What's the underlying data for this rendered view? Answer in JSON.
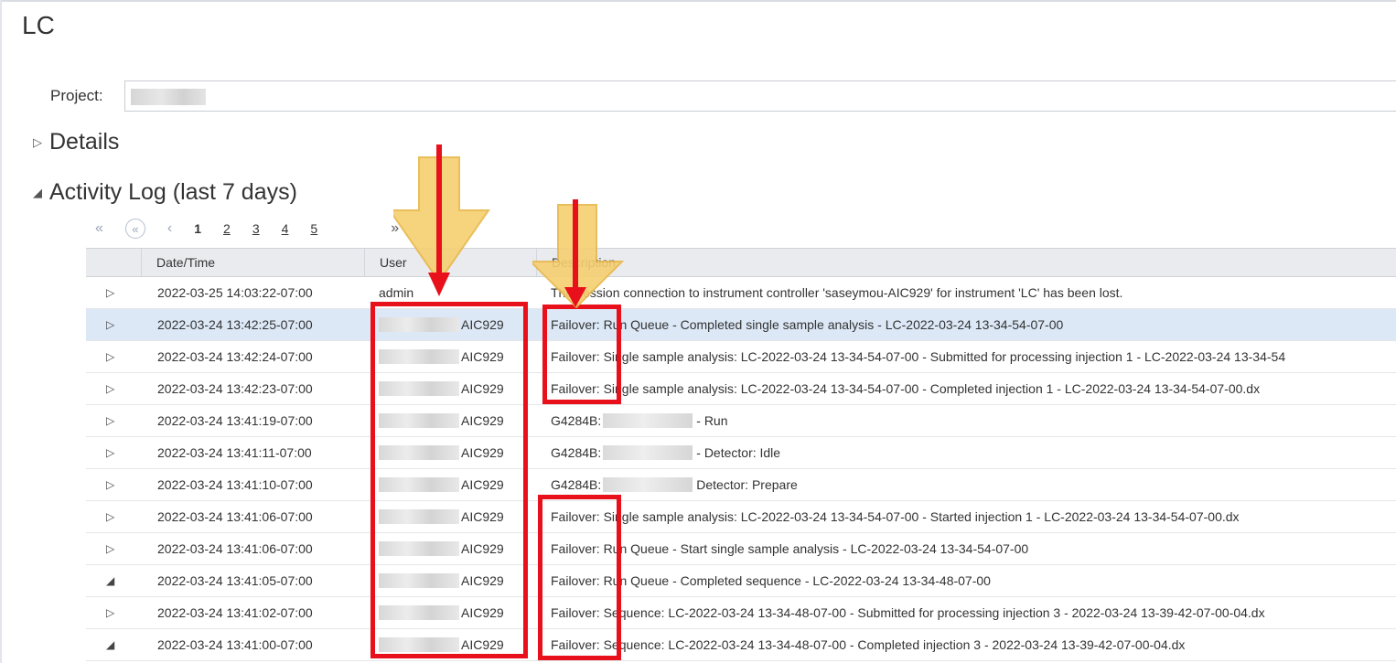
{
  "app": {
    "title": "LC"
  },
  "project": {
    "label": "Project:"
  },
  "sections": {
    "details": {
      "toggle": "▷",
      "label": "Details"
    },
    "activity": {
      "toggle": "◢",
      "label": "Activity Log (last 7 days)"
    }
  },
  "pager": {
    "first": "«",
    "prev_block": "«",
    "prev": "‹",
    "pages": [
      "1",
      "2",
      "3",
      "4",
      "5"
    ],
    "next_block": "»",
    "current": "1"
  },
  "table": {
    "columns": [
      "Date/Time",
      "User",
      "Description"
    ],
    "rows": [
      {
        "expand": "▷",
        "datetime": "2022-03-25 14:03:22-07:00",
        "user": "admin",
        "desc_pre": "",
        "desc": "The session connection to instrument controller 'saseymou-AIC929' for instrument 'LC' has been lost."
      },
      {
        "expand": "▷",
        "datetime": "2022-03-24 13:42:25-07:00",
        "user": "AIC929",
        "desc_pre": "",
        "desc": "Failover: Run Queue - Completed single sample analysis - LC-2022-03-24 13-34-54-07-00"
      },
      {
        "expand": "▷",
        "datetime": "2022-03-24 13:42:24-07:00",
        "user": "AIC929",
        "desc_pre": "",
        "desc": "Failover: Single sample analysis: LC-2022-03-24 13-34-54-07-00 - Submitted for processing injection 1 - LC-2022-03-24 13-34-54"
      },
      {
        "expand": "▷",
        "datetime": "2022-03-24 13:42:23-07:00",
        "user": "AIC929",
        "desc_pre": "",
        "desc": "Failover: Single sample analysis: LC-2022-03-24 13-34-54-07-00 - Completed injection 1 - LC-2022-03-24 13-34-54-07-00.dx"
      },
      {
        "expand": "▷",
        "datetime": "2022-03-24 13:41:19-07:00",
        "user": "AIC929",
        "desc_pre": "G4284B:",
        "desc": "- Run"
      },
      {
        "expand": "▷",
        "datetime": "2022-03-24 13:41:11-07:00",
        "user": "AIC929",
        "desc_pre": "G4284B:",
        "desc": "- Detector: Idle"
      },
      {
        "expand": "▷",
        "datetime": "2022-03-24 13:41:10-07:00",
        "user": "AIC929",
        "desc_pre": "G4284B:",
        "desc": "Detector: Prepare"
      },
      {
        "expand": "▷",
        "datetime": "2022-03-24 13:41:06-07:00",
        "user": "AIC929",
        "desc_pre": "",
        "desc": "Failover: Single sample analysis: LC-2022-03-24 13-34-54-07-00 - Started injection 1 - LC-2022-03-24 13-34-54-07-00.dx"
      },
      {
        "expand": "▷",
        "datetime": "2022-03-24 13:41:06-07:00",
        "user": "AIC929",
        "desc_pre": "",
        "desc": "Failover: Run Queue - Start single sample analysis - LC-2022-03-24 13-34-54-07-00"
      },
      {
        "expand": "◢",
        "datetime": "2022-03-24 13:41:05-07:00",
        "user": "AIC929",
        "desc_pre": "",
        "desc": "Failover: Run Queue - Completed sequence - LC-2022-03-24 13-34-48-07-00"
      },
      {
        "expand": "▷",
        "datetime": "2022-03-24 13:41:02-07:00",
        "user": "AIC929",
        "desc_pre": "",
        "desc": "Failover: Sequence: LC-2022-03-24 13-34-48-07-00 - Submitted for processing injection 3 - 2022-03-24 13-39-42-07-00-04.dx"
      },
      {
        "expand": "◢",
        "datetime": "2022-03-24 13:41:00-07:00",
        "user": "AIC929",
        "desc_pre": "",
        "desc": "Failover: Sequence: LC-2022-03-24 13-34-48-07-00 - Completed injection 3 - 2022-03-24 13-39-42-07-00-04.dx"
      }
    ],
    "selected_row": 1
  },
  "colors": {
    "highlight_box": "#e8101a",
    "arrow_fill": "#f6cf70",
    "arrow_line": "#e8101a",
    "selected_row": "#dce8f6"
  }
}
